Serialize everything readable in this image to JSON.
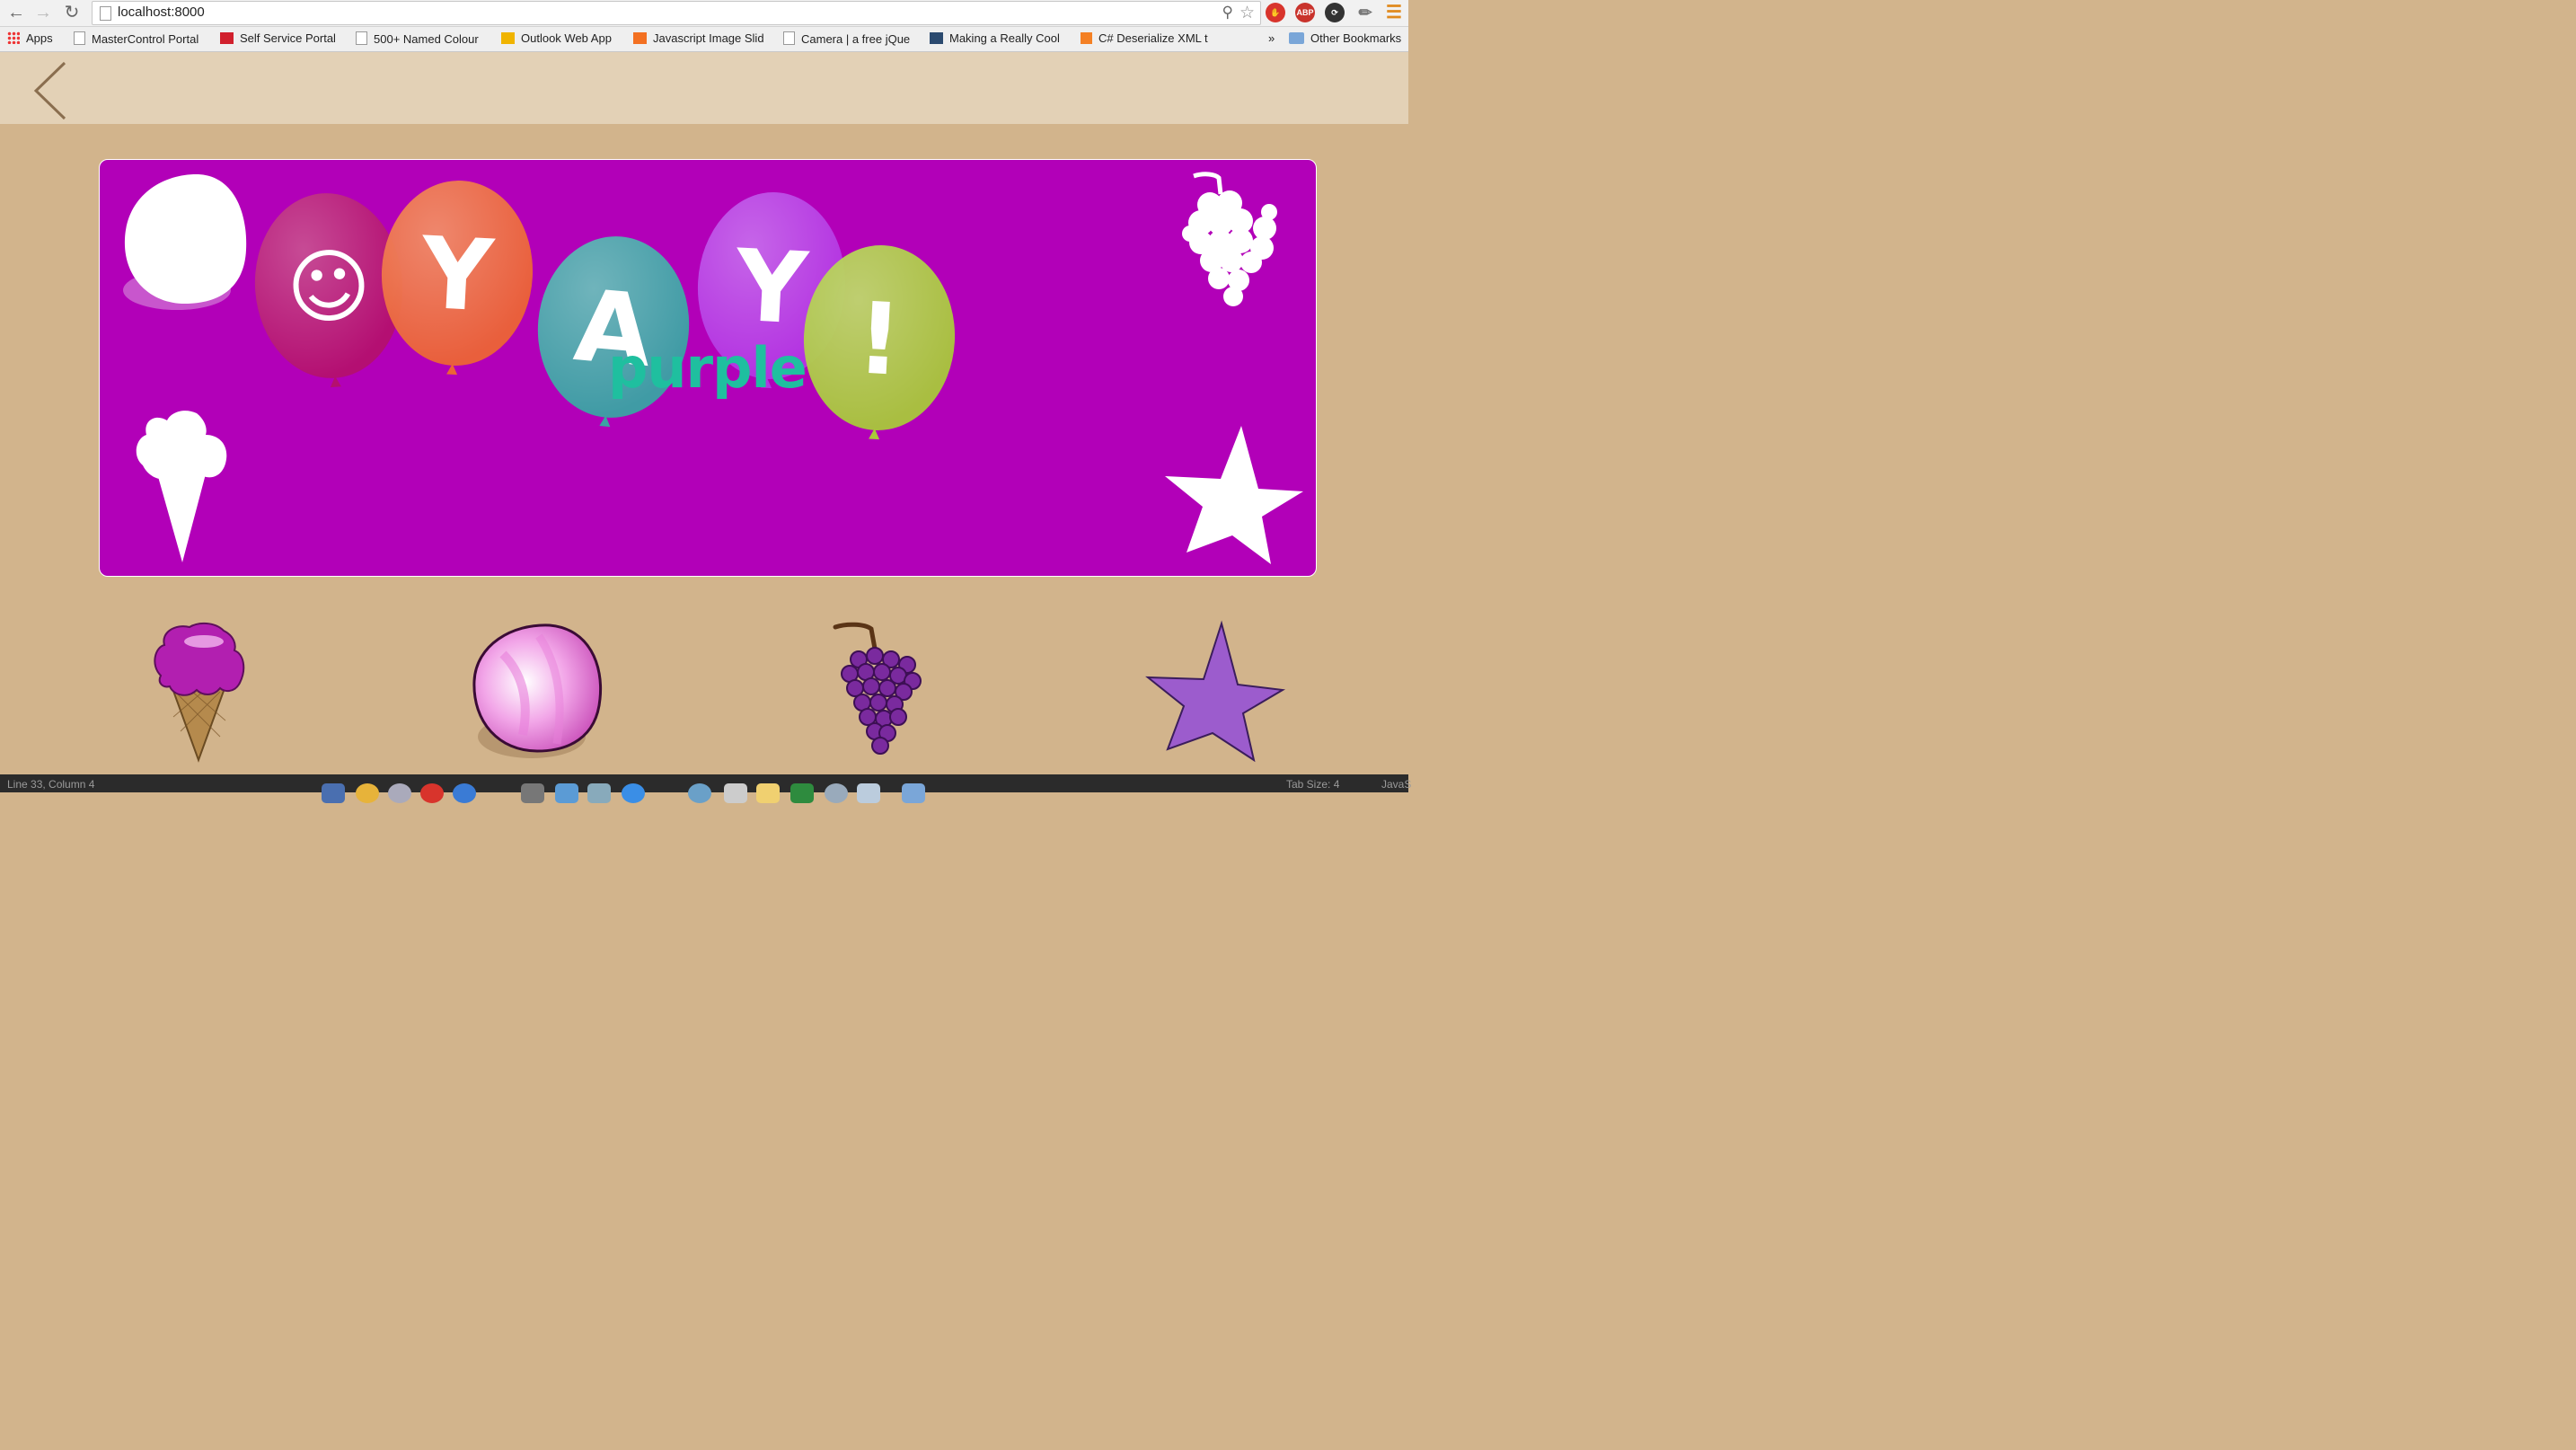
{
  "browser": {
    "url": "localhost:8000",
    "bookmarks": [
      {
        "label": "Apps"
      },
      {
        "label": "MasterControl Portal"
      },
      {
        "label": "Self Service Portal"
      },
      {
        "label": "500+ Named Colour"
      },
      {
        "label": "Outlook Web App"
      },
      {
        "label": "Javascript Image Slid"
      },
      {
        "label": "Camera | a free jQue"
      },
      {
        "label": "Making a Really Cool"
      },
      {
        "label": "C# Deserialize XML t"
      }
    ],
    "overflow": "»",
    "other_bookmarks": "Other Bookmarks",
    "extensions": [
      "ABP"
    ]
  },
  "game": {
    "color_word": "purple",
    "balloons": [
      {
        "glyph": "☺",
        "color": "#b4106e"
      },
      {
        "glyph": "Y",
        "color": "#ec6435"
      },
      {
        "glyph": "A",
        "color": "#3aa3a3"
      },
      {
        "glyph": "Y",
        "color": "#b335e3"
      },
      {
        "glyph": "!",
        "color": "#a9c83a"
      }
    ],
    "board_color": "#b200b8",
    "target_silhouettes": [
      "egg-silhouette",
      "grapes-silhouette",
      "ice-cream-silhouette",
      "star-silhouette"
    ],
    "tray_items": [
      "ice-cream",
      "egg",
      "grapes",
      "star"
    ]
  },
  "taskbar": {
    "left_status": "Line 33, Column 4",
    "tab_size": "Tab Size: 4",
    "language": "JavaS"
  }
}
